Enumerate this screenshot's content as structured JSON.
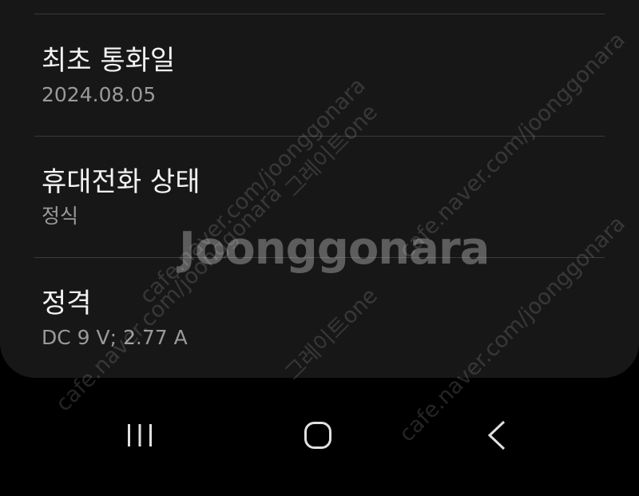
{
  "info": [
    {
      "title": "최초 통화일",
      "value": "2024.08.05"
    },
    {
      "title": "휴대전화 상태",
      "value": "정식"
    },
    {
      "title": "정격",
      "value": "DC 9 V; 2.77 A"
    }
  ],
  "nav": {
    "recents_icon": "recent-apps-icon",
    "home_icon": "home-icon",
    "back_icon": "back-icon"
  },
  "watermark": {
    "logo": "Joonggonara",
    "url": "cafe.naver.com/joonggonara",
    "brand": "그레이트one"
  },
  "colors": {
    "card_bg": "#171717",
    "screen_bg": "#000000",
    "title_text": "#f2f2f2",
    "value_text": "#9a9a9a"
  }
}
